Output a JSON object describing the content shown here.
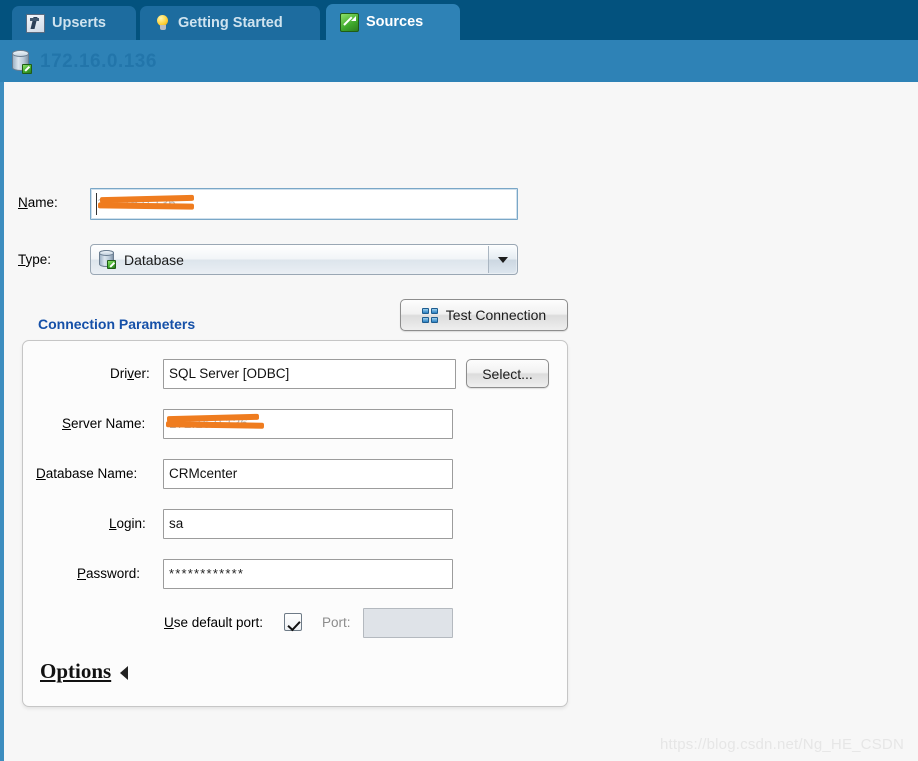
{
  "tabs": [
    {
      "label": "Upserts",
      "icon": "upserts-icon",
      "active": false
    },
    {
      "label": "Getting Started",
      "icon": "lightbulb-icon",
      "active": false
    },
    {
      "label": "Sources",
      "icon": "sources-icon",
      "active": true
    }
  ],
  "titlebar": {
    "icon": "database-source-icon",
    "title": "172.16.0.136",
    "redacted": true
  },
  "form": {
    "name": {
      "label": "Name:",
      "accel": "N",
      "value": "172.16.0.136",
      "redacted": true,
      "focused": true
    },
    "type": {
      "label": "Type:",
      "accel": "T",
      "value": "Database",
      "icon": "database-icon",
      "dropdown_icon": "chevron-down-icon"
    }
  },
  "connection": {
    "heading": "Connection Parameters",
    "heading_color": "#1550a8",
    "test_button": {
      "label": "Test Connection",
      "icon": "network-icon"
    },
    "fields": [
      {
        "key": "driver",
        "label": "Driver:",
        "accel": "v",
        "value": "SQL Server [ODBC]",
        "redacted": false,
        "disabled": false
      },
      {
        "key": "server",
        "label": "Server Name:",
        "accel": "S",
        "value": "172.16.0.136",
        "redacted": true,
        "disabled": false
      },
      {
        "key": "database",
        "label": "Database Name:",
        "accel": "D",
        "value": "CRMcenter",
        "redacted": false,
        "disabled": false
      },
      {
        "key": "login",
        "label": "Login:",
        "accel": "L",
        "value": "sa",
        "redacted": false,
        "disabled": false
      },
      {
        "key": "password",
        "label": "Password:",
        "accel": "P",
        "value": "************",
        "redacted": false,
        "disabled": false
      }
    ],
    "select_button": {
      "label": "Select..."
    },
    "use_default_port": {
      "label": "Use default port:",
      "accel": "U",
      "checked": true
    },
    "port": {
      "label": "Port:",
      "value": "",
      "disabled": true
    }
  },
  "options": {
    "label": "Options",
    "accel": "O",
    "expanded": false,
    "arrow_icon": "triangle-left-icon"
  },
  "watermark": {
    "text": "https://blog.csdn.net/Ng_HE_CSDN"
  },
  "colors": {
    "tabstrip_bg": "#03527e",
    "tab_inactive": "#1d6c9f",
    "tab_active": "#2e82b6",
    "titlebar_bg": "#2e82b6",
    "content_bg": "#f7f7f7",
    "left_strip": "#3d8dbf",
    "accent_heading": "#1550a8",
    "redaction": "#ef7c1f"
  }
}
